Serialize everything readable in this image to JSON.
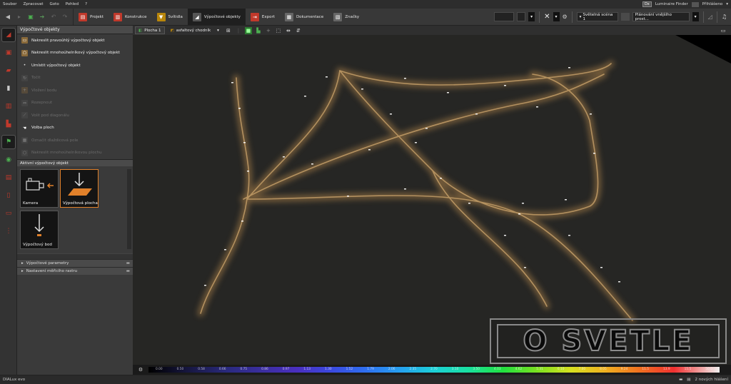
{
  "menu": [
    "Soubor",
    "Zpracovat",
    "Goto",
    "Pohled",
    "?"
  ],
  "menu_right": {
    "dx": "Dx",
    "finder": "Luminaire Finder",
    "login": "Přihlášeno"
  },
  "tabs": [
    {
      "label": "Projekt",
      "icon": "project-icon",
      "color": "#c0392b"
    },
    {
      "label": "Konstrukce",
      "icon": "construction-icon",
      "color": "#c0392b"
    },
    {
      "label": "Svítidla",
      "icon": "luminaire-icon",
      "color": "#b8860b"
    },
    {
      "label": "Výpočtové objekty",
      "icon": "calc-object-icon",
      "color": "#888888",
      "active": true
    },
    {
      "label": "Export",
      "icon": "export-icon",
      "color": "#c0392b"
    },
    {
      "label": "Dokumentace",
      "icon": "documentation-icon",
      "color": "#888888"
    },
    {
      "label": "Značky",
      "icon": "tags-icon",
      "color": "#888888"
    }
  ],
  "toolbar_right": {
    "scene_label": "Světelná scéna 1",
    "plan_label": "Plánování vnějšího prost..."
  },
  "panel": {
    "title": "Výpočtové objekty",
    "items": [
      {
        "label": "Nakreslit pravoúhlý výpočtový objekt",
        "enabled": true
      },
      {
        "label": "Nakreslit mnohoúhelníkový výpočtový objekt",
        "enabled": true
      },
      {
        "label": "Umístit výpočtový objekt",
        "enabled": true
      },
      {
        "label": "Točit",
        "enabled": false
      },
      {
        "label": "Vložení bodu",
        "enabled": false
      },
      {
        "label": "Rozepnout",
        "enabled": false
      },
      {
        "label": "Volit pod diagonálu",
        "enabled": false
      },
      {
        "label": "Volba ploch",
        "enabled": true
      },
      {
        "label": "Označit dlaždicová pole",
        "enabled": false
      },
      {
        "label": "Nakreslit mnohoúhelníkovou plochu",
        "enabled": false
      }
    ],
    "active_header": "Aktivní výpočtový objekt",
    "tiles": [
      {
        "label": "Kamera",
        "selected": false
      },
      {
        "label": "Výpočtová plocha",
        "selected": true
      },
      {
        "label": "Výpočtový bod",
        "selected": false
      }
    ],
    "collapsed": [
      "Výpočtové parametry",
      "Nastavení měřicího rastru"
    ]
  },
  "viewtool": {
    "plocha": "Plocha 1",
    "surface": "asfaltový chodník"
  },
  "colorbar": {
    "ticks": [
      "0.00",
      "0.50",
      "0.58",
      "0.66",
      "0.75",
      "0.86",
      "0.97",
      "1.13",
      "1.30",
      "1.52",
      "1.79",
      "2.06",
      "2.35",
      "2.70",
      "3.10",
      "3.50",
      "4.03",
      "4.62",
      "5.31",
      "6.10",
      "7.00",
      "8.05",
      "9.24",
      "11.5",
      "13.9",
      "15.5",
      "50.0"
    ]
  },
  "status": {
    "app": "DIALux evo",
    "messages": "2 nových hlášení"
  },
  "watermark": "O SVETLE"
}
